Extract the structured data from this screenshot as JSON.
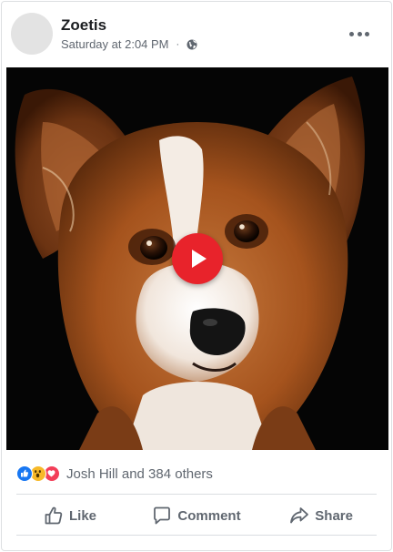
{
  "post": {
    "page_name": "Zoetis",
    "timestamp": "Saturday at 2:04 PM",
    "separator": "·",
    "privacy_icon": "globe-icon",
    "menu_icon": "more-icon"
  },
  "media": {
    "type": "video",
    "subject": "dog-portrait",
    "play_icon": "play-icon",
    "play_color": "#e8232b"
  },
  "reactions": {
    "icons": [
      "like-reaction-icon",
      "wow-reaction-icon",
      "love-reaction-icon"
    ],
    "summary": "Josh Hill and 384 others"
  },
  "actions": {
    "like_label": "Like",
    "comment_label": "Comment",
    "share_label": "Share"
  },
  "colors": {
    "text_primary": "#1c1e21",
    "text_secondary": "#606770",
    "like_blue": "#1877f2",
    "love_red": "#f33e58",
    "wow_yellow": "#f7b928"
  }
}
